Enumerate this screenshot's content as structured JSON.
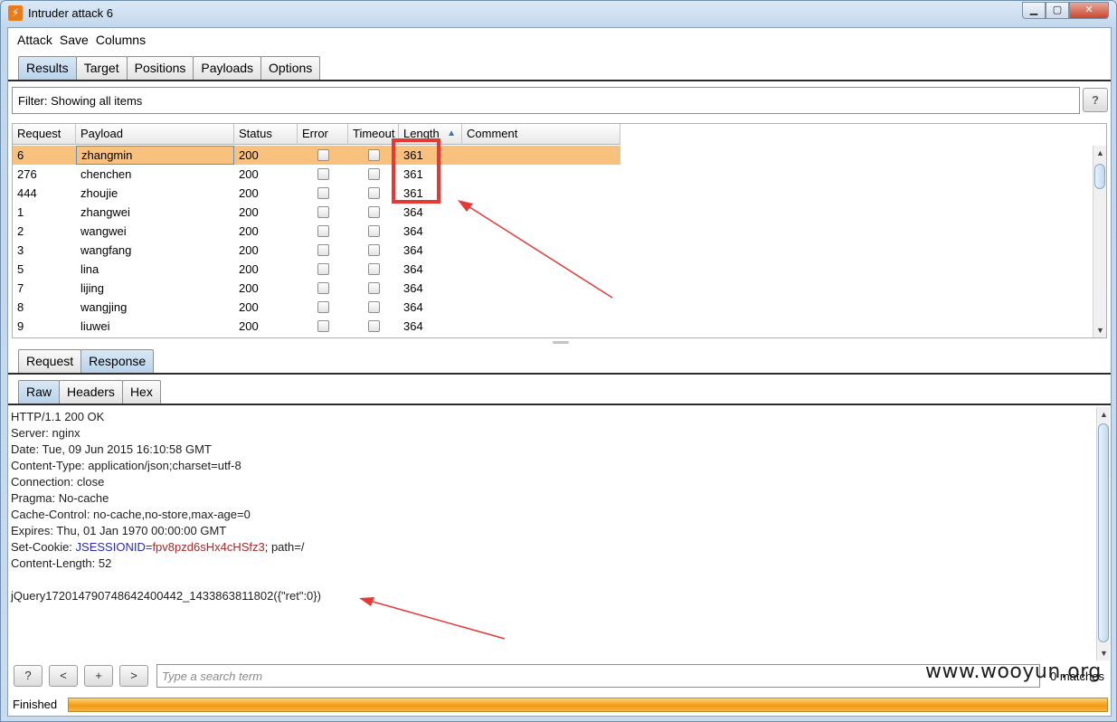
{
  "window": {
    "title": "Intruder attack 6",
    "app_icon_glyph": "⚡"
  },
  "menu": [
    "Attack",
    "Save",
    "Columns"
  ],
  "top_tabs": [
    {
      "label": "Results",
      "active": true
    },
    {
      "label": "Target",
      "active": false
    },
    {
      "label": "Positions",
      "active": false
    },
    {
      "label": "Payloads",
      "active": false
    },
    {
      "label": "Options",
      "active": false
    }
  ],
  "filter": {
    "text": "Filter: Showing all items",
    "help_label": "?"
  },
  "table": {
    "columns": [
      "Request",
      "Payload",
      "Status",
      "Error",
      "Timeout",
      "Length",
      "Comment"
    ],
    "sort_column": "Length",
    "rows": [
      {
        "request": "6",
        "payload": "zhangmin",
        "status": "200",
        "length": "361",
        "selected": true
      },
      {
        "request": "276",
        "payload": "chenchen",
        "status": "200",
        "length": "361"
      },
      {
        "request": "444",
        "payload": "zhoujie",
        "status": "200",
        "length": "361"
      },
      {
        "request": "1",
        "payload": "zhangwei",
        "status": "200",
        "length": "364"
      },
      {
        "request": "2",
        "payload": "wangwei",
        "status": "200",
        "length": "364"
      },
      {
        "request": "3",
        "payload": "wangfang",
        "status": "200",
        "length": "364"
      },
      {
        "request": "5",
        "payload": "lina",
        "status": "200",
        "length": "364"
      },
      {
        "request": "7",
        "payload": "lijing",
        "status": "200",
        "length": "364"
      },
      {
        "request": "8",
        "payload": "wangjing",
        "status": "200",
        "length": "364"
      },
      {
        "request": "9",
        "payload": "liuwei",
        "status": "200",
        "length": "364"
      }
    ]
  },
  "message_tabs": [
    {
      "label": "Request",
      "active": false
    },
    {
      "label": "Response",
      "active": true
    }
  ],
  "view_tabs": [
    {
      "label": "Raw",
      "active": true
    },
    {
      "label": "Headers",
      "active": false
    },
    {
      "label": "Hex",
      "active": false
    }
  ],
  "response": {
    "lines": [
      "HTTP/1.1 200 OK",
      "Server: nginx",
      "Date: Tue, 09 Jun 2015 16:10:58 GMT",
      "Content-Type: application/json;charset=utf-8",
      "Connection: close",
      "Pragma: No-cache",
      "Cache-Control: no-cache,no-store,max-age=0",
      "Expires: Thu, 01 Jan 1970 00:00:00 GMT"
    ],
    "cookie_prefix": "Set-Cookie: ",
    "cookie_name": "JSESSIONID",
    "cookie_eq": "=",
    "cookie_value": "fpv8pzd6sHx4cHSfz3",
    "cookie_suffix": "; path=/",
    "content_length": "Content-Length: 52",
    "body": "jQuery17201479074864240044​2_1433863811802({\"ret\":0})"
  },
  "search": {
    "help_label": "?",
    "prev_label": "<",
    "add_label": "+",
    "next_label": ">",
    "placeholder": "Type a search term",
    "matches": "0 matches"
  },
  "status": {
    "text": "Finished",
    "progress": 1.0
  },
  "watermark": "www.wooyun.org",
  "colors": {
    "selected_row": "#f8c17e",
    "annotation": "#e53935",
    "progress": "#f29b10"
  }
}
